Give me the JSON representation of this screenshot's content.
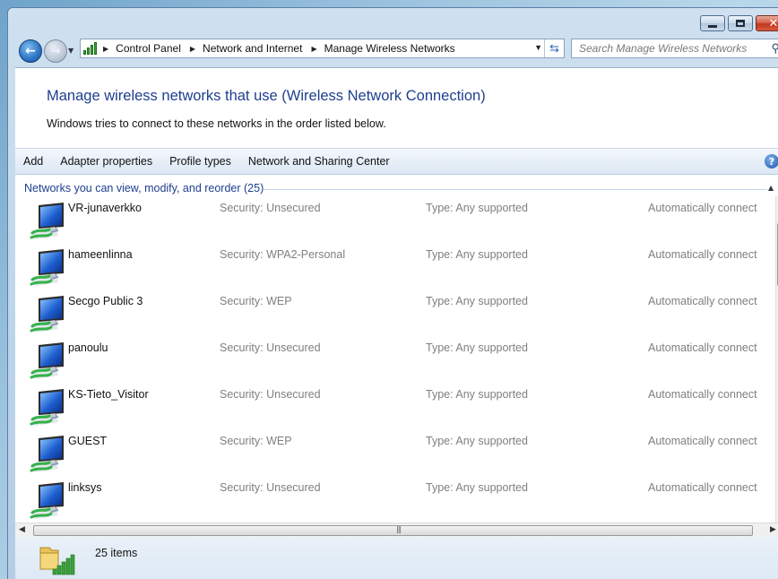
{
  "address_bar": {
    "breadcrumbs": [
      "Control Panel",
      "Network and Internet",
      "Manage Wireless Networks"
    ]
  },
  "search": {
    "placeholder": "Search Manage Wireless Networks"
  },
  "header": {
    "title": "Manage wireless networks that use (Wireless Network Connection)",
    "subtitle": "Windows tries to connect to these networks in the order listed below."
  },
  "toolbar": {
    "add": "Add",
    "adapter": "Adapter properties",
    "profile": "Profile types",
    "sharing": "Network and Sharing Center"
  },
  "group": {
    "label": "Networks you can view, modify, and reorder (25)"
  },
  "networks": [
    {
      "name": "VR-junaverkko",
      "security": "Security:  Unsecured",
      "type": "Type:  Any supported",
      "connect": "Automatically connect"
    },
    {
      "name": "hameenlinna",
      "security": "Security:  WPA2-Personal",
      "type": "Type:  Any supported",
      "connect": "Automatically connect"
    },
    {
      "name": "Secgo Public 3",
      "security": "Security:  WEP",
      "type": "Type:  Any supported",
      "connect": "Automatically connect"
    },
    {
      "name": "panoulu",
      "security": "Security:  Unsecured",
      "type": "Type:  Any supported",
      "connect": "Automatically connect"
    },
    {
      "name": "KS-Tieto_Visitor",
      "security": "Security:  Unsecured",
      "type": "Type:  Any supported",
      "connect": "Automatically connect"
    },
    {
      "name": "GUEST",
      "security": "Security:  WEP",
      "type": "Type:  Any supported",
      "connect": "Automatically connect"
    },
    {
      "name": "linksys",
      "security": "Security:  Unsecured",
      "type": "Type:  Any supported",
      "connect": "Automatically connect"
    }
  ],
  "status": {
    "items": "25 items"
  },
  "colors": {
    "title_blue": "#1e3f8f",
    "muted_gray": "#7f7f7f",
    "signal_green": "#3aa23a"
  }
}
